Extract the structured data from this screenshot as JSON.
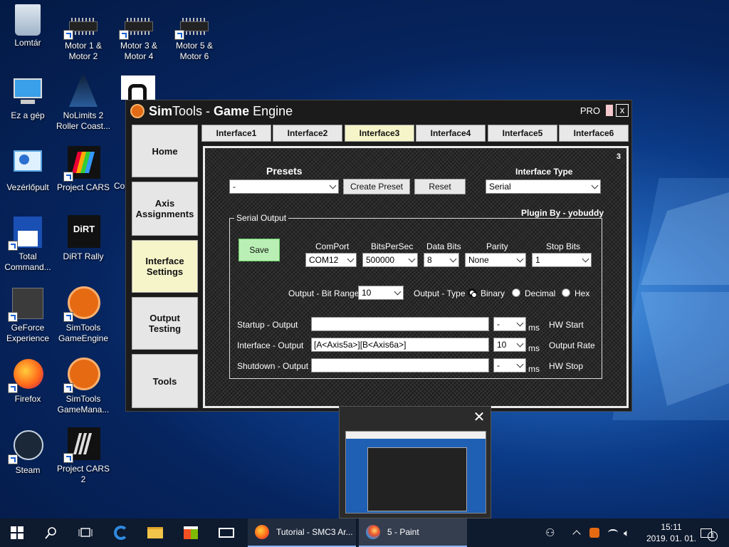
{
  "desktop": {
    "icons": [
      {
        "label": "Lomtár"
      },
      {
        "label": "Motor 1 & Motor 2"
      },
      {
        "label": "Motor 3 & Motor 4"
      },
      {
        "label": "Motor 5 & Motor 6"
      },
      {
        "label": "Ez a gép"
      },
      {
        "label": "NoLimits 2 Roller Coast..."
      },
      {
        "label": "Vezérlőpult"
      },
      {
        "label": "Project CARS"
      },
      {
        "label": "Co"
      },
      {
        "label": "Total Command..."
      },
      {
        "label": "DiRT Rally"
      },
      {
        "label": "GeForce Experience"
      },
      {
        "label": "SimTools GameEngine"
      },
      {
        "label": "Firefox"
      },
      {
        "label": "SimTools GameMana..."
      },
      {
        "label": "Steam"
      },
      {
        "label": "Project CARS 2"
      }
    ]
  },
  "simtools": {
    "title_prefix": "Sim",
    "title_tools": "Tools - ",
    "title_bold": "Game",
    "title_suffix": " Engine",
    "pro_label": "PRO",
    "close_label": "x",
    "sidebar": [
      {
        "label": "Home"
      },
      {
        "label": "Axis Assignments"
      },
      {
        "label": "Interface Settings"
      },
      {
        "label": "Output Testing"
      },
      {
        "label": "Tools"
      }
    ],
    "tabs": [
      {
        "label": "Interface1"
      },
      {
        "label": "Interface2"
      },
      {
        "label": "Interface3"
      },
      {
        "label": "Interface4"
      },
      {
        "label": "Interface5"
      },
      {
        "label": "Interface6"
      }
    ],
    "panel_number": "3",
    "presets_label": "Presets",
    "presets_value": "-",
    "create_preset_label": "Create Preset",
    "reset_label": "Reset",
    "interface_type_label": "Interface Type",
    "interface_type_value": "Serial",
    "plugin_by": "Plugin By - yobuddy",
    "serial_output_label": "Serial Output",
    "save_label": "Save",
    "comport_label": "ComPort",
    "comport_value": "COM12",
    "bits_label": "BitsPerSec",
    "bits_value": "500000",
    "databits_label": "Data Bits",
    "databits_value": "8",
    "parity_label": "Parity",
    "parity_value": "None",
    "stopbits_label": "Stop Bits",
    "stopbits_value": "1",
    "bitrange_label": "Output - Bit Range",
    "bitrange_value": "10",
    "outtype_label": "Output - Type",
    "binary_label": "Binary",
    "decimal_label": "Decimal",
    "hex_label": "Hex",
    "startup_label": "Startup - Output",
    "startup_value": "",
    "startup_ms": "-",
    "interface_label": "Interface - Output",
    "interface_value": "[A<Axis5a>][B<Axis6a>]",
    "interface_ms": "10",
    "shutdown_label": "Shutdown - Output",
    "shutdown_value": "",
    "shutdown_ms": "-",
    "ms_label": "ms",
    "hw_start_label": "HW Start",
    "output_rate_label": "Output Rate",
    "hw_stop_label": "HW Stop"
  },
  "thumbnail": {
    "close_label": "✕"
  },
  "taskbar": {
    "apps": [
      {
        "label": "Tutorial - SMC3 Ar..."
      },
      {
        "label": "5 - Paint"
      }
    ],
    "time": "15:11",
    "date": "2019. 01. 01.",
    "notification_count": "1"
  }
}
